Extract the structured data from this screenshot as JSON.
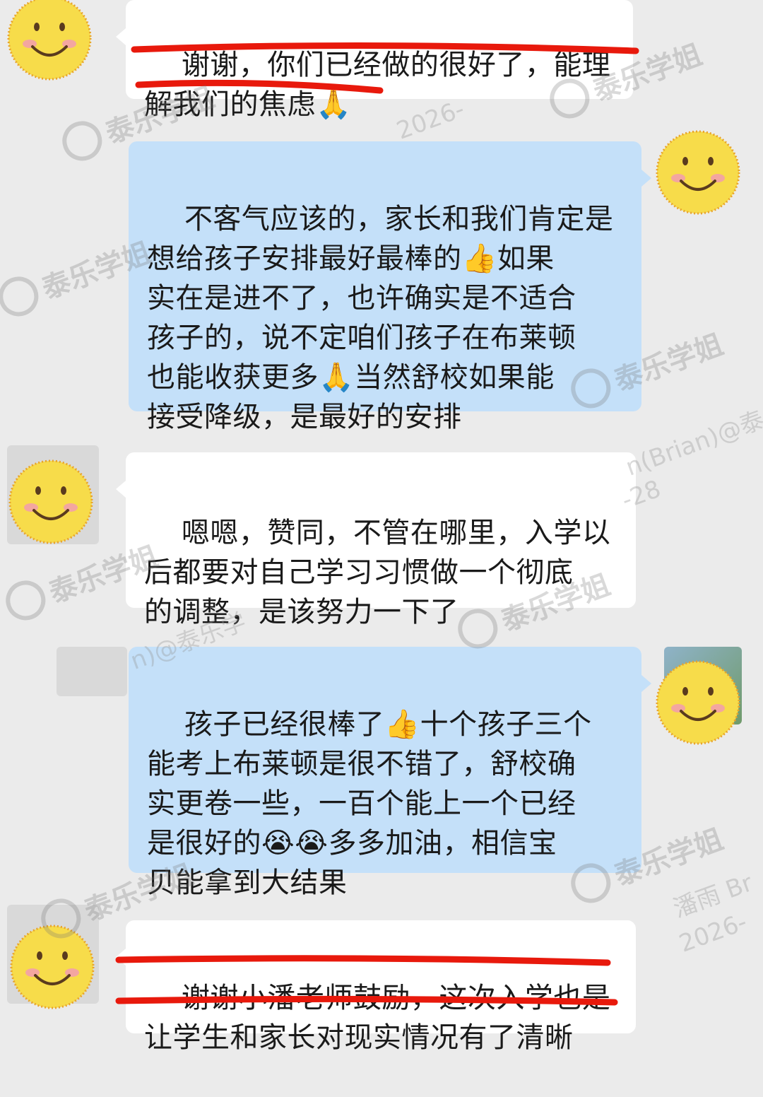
{
  "messages": [
    {
      "side": "left",
      "text": "谢谢，你们已经做的很好了，能理\n解我们的焦虑🙏"
    },
    {
      "side": "right",
      "text": "不客气应该的，家长和我们肯定是\n想给孩子安排最好最棒的👍如果\n实在是进不了，也许确实是不适合\n孩子的，说不定咱们孩子在布莱顿\n也能收获更多🙏当然舒校如果能\n接受降级，是最好的安排"
    },
    {
      "side": "left",
      "text": "嗯嗯，赞同，不管在哪里，入学以\n后都要对自己学习习惯做一个彻底\n的调整，是该努力一下了"
    },
    {
      "side": "right",
      "text": "孩子已经很棒了👍十个孩子三个\n能考上布莱顿是很不错了，舒校确\n实更卷一些，一百个能上一个已经\n是很好的😭😭多多加油，相信宝\n贝能拿到大结果"
    },
    {
      "side": "left",
      "text": "谢谢小潘老师鼓励，这次入学也是\n让学生和家长对现实情况有了清晰"
    }
  ],
  "watermark": {
    "brand": "泰乐学姐"
  },
  "meta_watermarks": [
    "2026-",
    "n(Brian)@泰",
    "-28",
    "n)@泰乐学",
    "潘雨 Br",
    "2026-"
  ],
  "colors": {
    "left_bubble": "#ffffff",
    "right_bubble": "#c4e0f9",
    "background": "#ebebeb",
    "underline": "#e8190c",
    "smiley": "#f7dc4a"
  },
  "icons": {
    "avatar": "smiley-face-icon",
    "watermark_logo": "tl-logo-icon"
  }
}
